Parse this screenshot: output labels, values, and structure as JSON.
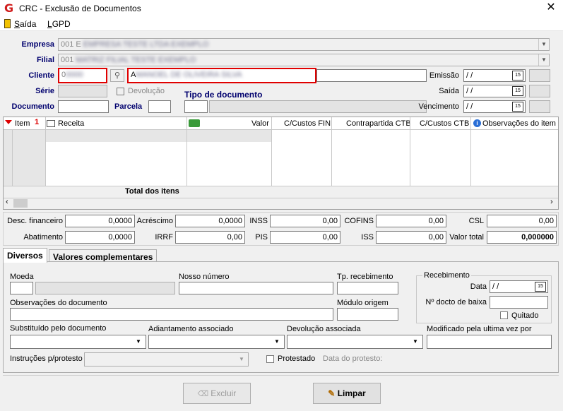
{
  "window": {
    "title": "CRC - Exclusão de Documentos",
    "close": "✕"
  },
  "menu": [
    {
      "label": "Saída",
      "key": "S",
      "rest": "aída"
    },
    {
      "label": "LGPD",
      "key": "L",
      "rest": "GPD"
    }
  ],
  "header": {
    "empresa_label": "Empresa",
    "empresa_value": "001 E",
    "filial_label": "Filial",
    "filial_value": "001",
    "cliente_label": "Cliente",
    "cliente_code": "0",
    "cliente_name": "A",
    "serie_label": "Série",
    "devolucao_label": "Devolução",
    "tipo_doc_label": "Tipo de documento",
    "documento_label": "Documento",
    "parcela_label": "Parcela",
    "emissao_label": "Emissão",
    "emissao_value": " / /",
    "saida_label": "Saída",
    "saida_value": " / /",
    "vencimento_label": "Vencimento",
    "vencimento_value": " / /"
  },
  "grid": {
    "columns": [
      "Item",
      "Receita",
      "Valor",
      "C/Custos FIN",
      "Contrapartida CTB",
      "C/Custos CTB",
      "Observações do item"
    ],
    "sort_marker": "1",
    "total_label": "Total dos itens"
  },
  "totals": {
    "desc_fin_label": "Desc. financeiro",
    "desc_fin": "0,0000",
    "acrescimo_label": "Acréscimo",
    "acrescimo": "0,0000",
    "inss_label": "INSS",
    "inss": "0,00",
    "cofins_label": "COFINS",
    "cofins": "0,00",
    "csl_label": "CSL",
    "csl": "0,00",
    "abatimento_label": "Abatimento",
    "abatimento": "0,0000",
    "irrf_label": "IRRF",
    "irrf": "0,00",
    "pis_label": "PIS",
    "pis": "0,00",
    "iss_label": "ISS",
    "iss": "0,00",
    "valor_total_label": "Valor total",
    "valor_total": "0,000000"
  },
  "tabs": [
    "Diversos",
    "Valores complementares"
  ],
  "diversos": {
    "moeda_label": "Moeda",
    "nosso_numero_label": "Nosso número",
    "tp_recebimento_label": "Tp. recebimento",
    "recebimento_group": "Recebimento",
    "data_label": "Data",
    "data_value": " / /",
    "obs_doc_label": "Observações do documento",
    "modulo_origem_label": "Módulo origem",
    "ndocto_baixa_label": "Nº docto de baixa",
    "quitado_label": "Quitado",
    "substituido_label": "Substituído pelo documento",
    "adiantamento_label": "Adiantamento associado",
    "devolucao_assoc_label": "Devolução associada",
    "modificado_label": "Modificado pela ultima vez por",
    "instrucoes_label": "Instruções p/protesto",
    "protestado_label": "Protestado",
    "data_protesto_label": "Data do protesto:"
  },
  "buttons": {
    "excluir": "Excluir",
    "limpar": "Limpar"
  }
}
